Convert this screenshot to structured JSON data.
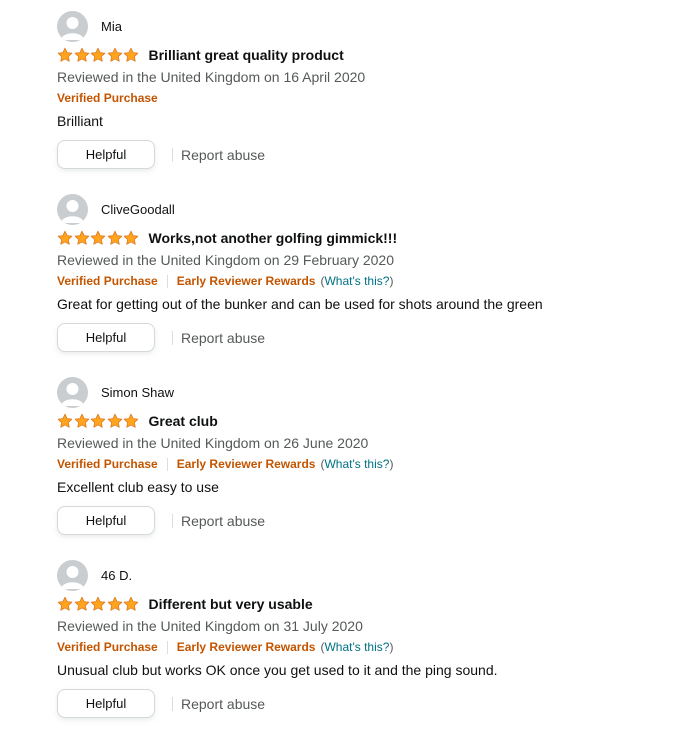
{
  "colors": {
    "star_fill": "#ffa41c",
    "star_stroke": "#de7921",
    "verified": "#c45500",
    "link": "#007185",
    "muted": "#565959",
    "text": "#0f1111"
  },
  "icons": {
    "avatar": "default-user-avatar-icon",
    "star": "star-icon"
  },
  "reviews": [
    {
      "profile_name": "Mia",
      "rating": 5,
      "title": "Brilliant great quality product",
      "date": "Reviewed in the United Kingdom on 16 April 2020",
      "verified": "Verified Purchase",
      "early_reviewer": "",
      "whats_this": "",
      "body": "Brilliant",
      "helpful_label": "Helpful",
      "report_label": "Report abuse"
    },
    {
      "profile_name": "CliveGoodall",
      "rating": 5,
      "title": "Works,not another golfing gimmick!!!",
      "date": "Reviewed in the United Kingdom on 29 February 2020",
      "verified": "Verified Purchase",
      "early_reviewer": "Early Reviewer Rewards",
      "whats_this": "What's this?",
      "body": "Great for getting out of the bunker and can be used for shots around the green",
      "helpful_label": "Helpful",
      "report_label": "Report abuse"
    },
    {
      "profile_name": "Simon Shaw",
      "rating": 5,
      "title": "Great club",
      "date": "Reviewed in the United Kingdom on 26 June 2020",
      "verified": "Verified Purchase",
      "early_reviewer": "Early Reviewer Rewards",
      "whats_this": "What's this?",
      "body": "Excellent club easy to use",
      "helpful_label": "Helpful",
      "report_label": "Report abuse"
    },
    {
      "profile_name": "46 D.",
      "rating": 5,
      "title": "Different but very usable",
      "date": "Reviewed in the United Kingdom on 31 July 2020",
      "verified": "Verified Purchase",
      "early_reviewer": "Early Reviewer Rewards",
      "whats_this": "What's this?",
      "body": "Unusual club but works OK once you get used to it and the ping sound.",
      "helpful_label": "Helpful",
      "report_label": "Report abuse"
    }
  ]
}
